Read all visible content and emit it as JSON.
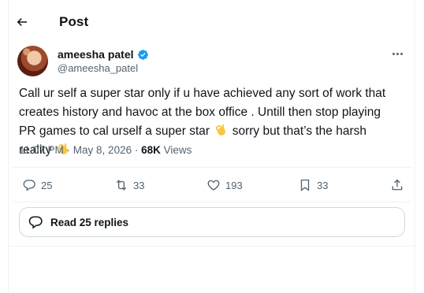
{
  "header": {
    "title": "Post"
  },
  "author": {
    "name": "ameesha patel",
    "handle": "@ameesha_patel"
  },
  "post": {
    "text_part1": "Call ur self a super star only if u have achieved any sort of work that creates history and havoc  at the box office . Untill then stop playing PR games to cal urself a super star",
    "text_part2": "sorry but that’s the harsh reality",
    "emoji_name": "ok-hand-emoji"
  },
  "meta": {
    "time": "11:07 PM",
    "separator": " · ",
    "date": "May 8, 2026",
    "views_count": "68K",
    "views_label": " Views"
  },
  "actions": {
    "replies": "25",
    "reposts": "33",
    "likes": "193",
    "bookmarks": "33"
  },
  "replies_button": {
    "label": "Read 25 replies"
  },
  "colors": {
    "verified": "#1d9bf0",
    "muted": "#536471",
    "text": "#0f1419",
    "emoji": "#f7c744"
  }
}
